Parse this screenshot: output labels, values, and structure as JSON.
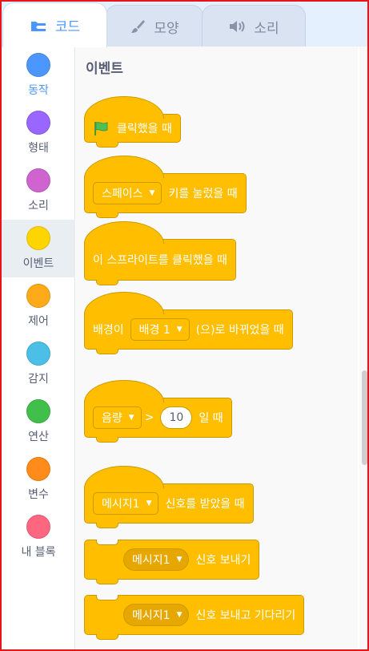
{
  "tabs": [
    {
      "label": "코드",
      "icon": "code-icon",
      "active": true
    },
    {
      "label": "모양",
      "icon": "brush-icon",
      "active": false
    },
    {
      "label": "소리",
      "icon": "speaker-icon",
      "active": false
    }
  ],
  "categories": [
    {
      "label": "동작",
      "color": "#4c97ff"
    },
    {
      "label": "형태",
      "color": "#9966ff"
    },
    {
      "label": "소리",
      "color": "#cf63cf"
    },
    {
      "label": "이벤트",
      "color": "#ffd500"
    },
    {
      "label": "제어",
      "color": "#ffab19"
    },
    {
      "label": "감지",
      "color": "#4cbfe6"
    },
    {
      "label": "연산",
      "color": "#40bf4a"
    },
    {
      "label": "변수",
      "color": "#ff8c1a"
    },
    {
      "label": "내 블록",
      "color": "#ff6680"
    }
  ],
  "palette": {
    "section_title": "이벤트",
    "blocks": {
      "flag_clicked": {
        "text": "클릭했을 때"
      },
      "key_pressed": {
        "dropdown": "스페이스",
        "text": "키를 눌렀을 때"
      },
      "sprite_clicked": {
        "text": "이 스프라이트를 클릭했을 때"
      },
      "backdrop_switch": {
        "prefix": "배경이",
        "dropdown": "배경 1",
        "suffix": "(으)로 바뀌었을 때"
      },
      "greater_than": {
        "dropdown": "음량",
        "operator": ">",
        "value": "10",
        "suffix": "일 때"
      },
      "receive": {
        "dropdown": "메시지1",
        "text": "신호를 받았을 때"
      },
      "broadcast": {
        "dropdown": "메시지1",
        "text": "신호 보내기"
      },
      "broadcast_wait": {
        "dropdown": "메시지1",
        "text": "신호 보내고 기다리기"
      }
    }
  },
  "colors": {
    "event_block": "#ffbf00",
    "event_block_border": "#cc9900",
    "accent": "#4c97ff"
  }
}
